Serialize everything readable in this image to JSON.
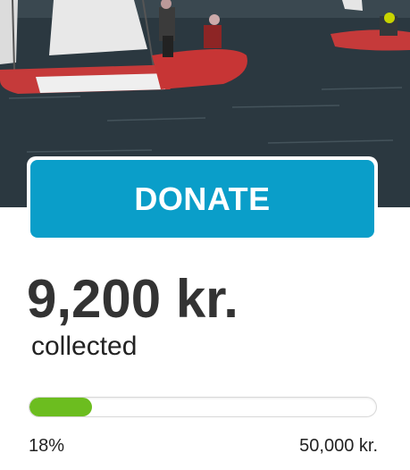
{
  "donate": {
    "button_label": "DONATE"
  },
  "stats": {
    "amount": "9,200 kr.",
    "collected_label": "collected",
    "percent_label": "18%",
    "goal_label": "50,000 kr.",
    "progress_fraction": 0.18
  },
  "colors": {
    "button": "#0a9ec9",
    "progress_fill": "#6cbd1f",
    "amount_text": "#333333"
  }
}
